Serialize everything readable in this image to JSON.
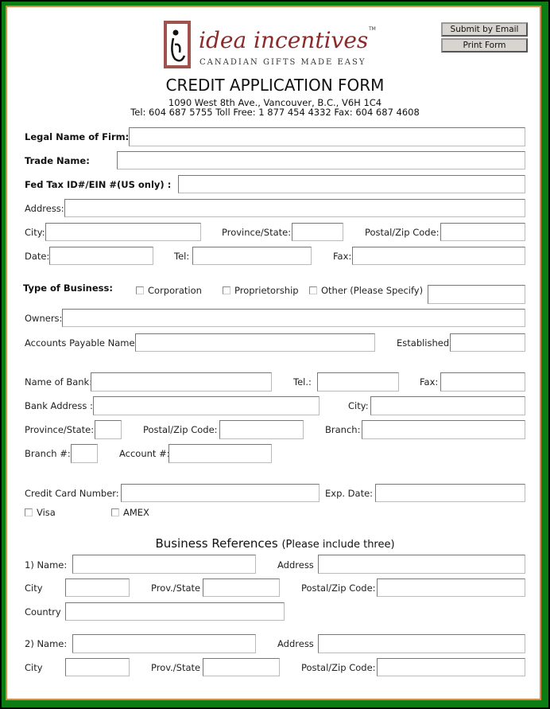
{
  "buttons": {
    "submit_email": "Submit by Email",
    "print_form": "Print Form"
  },
  "logo": {
    "brand": "idea incentives",
    "tm": "™",
    "tagline": "CANADIAN GIFTS MADE EASY",
    "colors": {
      "frame": "#a0524d",
      "script": "#8b2a2a"
    }
  },
  "header": {
    "title": "CREDIT APPLICATION FORM",
    "address": "1090 West 8th Ave., Vancouver, B.C.,  V6H 1C4",
    "phones": "Tel: 604 687 5755 Toll Free: 1 877 454 4332 Fax: 604 687 4608"
  },
  "labels": {
    "legal_name": "Legal Name of Firm:",
    "trade_name": "Trade Name:",
    "fed_tax": "Fed Tax ID#/EIN #(US only) :",
    "address": "Address:",
    "city": "City:",
    "province": "Province/State:",
    "postal": "Postal/Zip Code:",
    "date": "Date:",
    "tel": "Tel:",
    "fax": "Fax:",
    "type_business": "Type of Business:",
    "corporation": "Corporation",
    "proprietorship": "Proprietorship",
    "other": "Other (Please Specify)",
    "owners": "Owners:",
    "ap_name": "Accounts Payable Name:",
    "established": "Established:",
    "bank_name": "Name of Bank:",
    "bank_tel": "Tel.:",
    "bank_fax": "Fax:",
    "bank_address": "Bank Address :",
    "bank_city": "City:",
    "bank_province": "Province/State:",
    "bank_postal": "Postal/Zip Code:",
    "branch": "Branch:",
    "branch_no": "Branch #:",
    "account_no": "Account #:",
    "cc_number": "Credit Card Number:",
    "exp_date": "Exp. Date:",
    "visa": "Visa",
    "amex": "AMEX",
    "ref1_name": "1)  Name:",
    "ref_address": "Address",
    "ref_city": "City",
    "ref_prov": "Prov./State",
    "ref_postal": "Postal/Zip Code:",
    "ref_country": "Country",
    "ref2_name": "2)  Name:"
  },
  "references": {
    "heading": "Business References ",
    "note": "(Please include three)"
  },
  "values": {}
}
